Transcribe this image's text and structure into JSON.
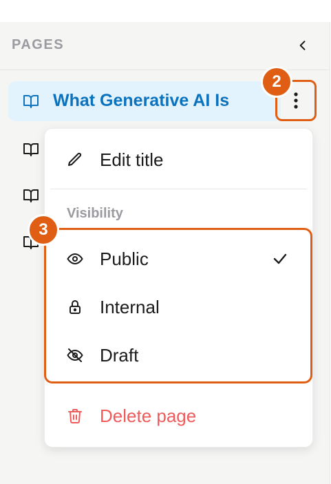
{
  "sidebar": {
    "title": "PAGES",
    "collapse_icon": "chevron-left-icon",
    "pages": [
      {
        "label": "What Generative AI Is",
        "icon": "book-open-icon",
        "active": true
      },
      {
        "label": "",
        "icon": "book-open-icon",
        "active": false
      },
      {
        "label": "",
        "icon": "book-open-icon",
        "active": false
      },
      {
        "label": "",
        "icon": "book-open-icon",
        "active": false
      }
    ],
    "more_icon": "more-vertical-icon"
  },
  "menu": {
    "edit_title": "Edit title",
    "visibility_label": "Visibility",
    "options": [
      {
        "label": "Public",
        "icon": "eye-icon",
        "selected": true
      },
      {
        "label": "Internal",
        "icon": "lock-icon",
        "selected": false
      },
      {
        "label": "Draft",
        "icon": "eye-off-icon",
        "selected": false
      }
    ],
    "delete_page": "Delete page"
  },
  "annotations": {
    "badge_2": "2",
    "badge_3": "3"
  },
  "colors": {
    "accent": "#0b72bd",
    "active_bg": "#e2f3fd",
    "highlight": "#e05e14",
    "danger": "#ef5a5a"
  }
}
